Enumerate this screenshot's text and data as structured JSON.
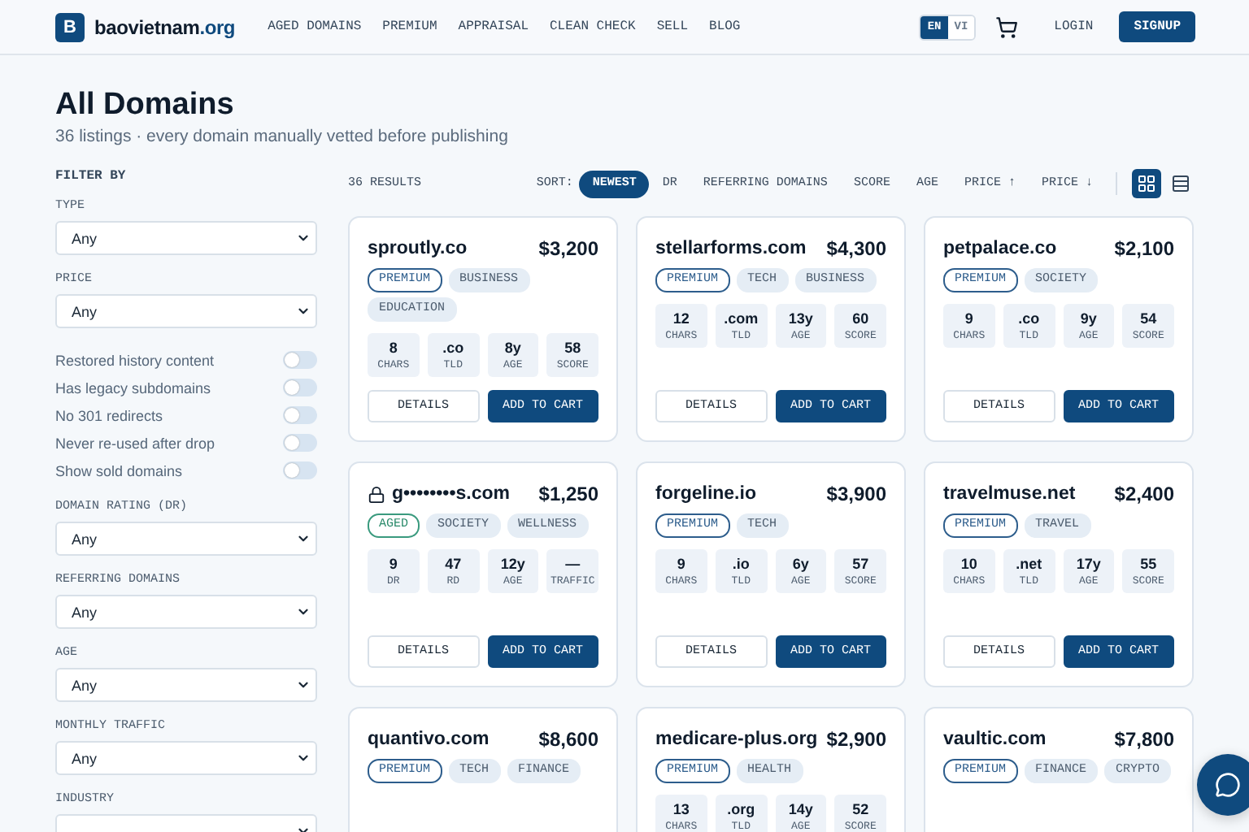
{
  "header": {
    "logo_letter": "B",
    "logo_name": "baovietnam",
    "logo_tld": ".org",
    "nav": [
      "AGED DOMAINS",
      "PREMIUM",
      "APPRAISAL",
      "CLEAN CHECK",
      "SELL",
      "BLOG"
    ],
    "languages": [
      {
        "label": "EN",
        "selected": true
      },
      {
        "label": "VI",
        "selected": false
      }
    ],
    "login": "LOGIN",
    "signup": "SIGNUP"
  },
  "page": {
    "title": "All Domains",
    "subtitle": "36 listings · every domain manually vetted before publishing"
  },
  "sidebar": {
    "title": "FILTER BY",
    "filters": [
      {
        "kind": "select",
        "label": "TYPE",
        "value": "Any"
      },
      {
        "kind": "select",
        "label": "PRICE",
        "value": "Any"
      },
      {
        "kind": "toggle",
        "label": "Restored history content",
        "on": false
      },
      {
        "kind": "toggle",
        "label": "Has legacy subdomains",
        "on": false
      },
      {
        "kind": "toggle",
        "label": "No 301 redirects",
        "on": false
      },
      {
        "kind": "toggle",
        "label": "Never re-used after drop",
        "on": false
      },
      {
        "kind": "toggle",
        "label": "Show sold domains",
        "on": false
      },
      {
        "kind": "select",
        "label": "DOMAIN RATING (DR)",
        "value": "Any"
      },
      {
        "kind": "select",
        "label": "REFERRING DOMAINS",
        "value": "Any"
      },
      {
        "kind": "select",
        "label": "AGE",
        "value": "Any"
      },
      {
        "kind": "select",
        "label": "MONTHLY TRAFFIC",
        "value": "Any"
      },
      {
        "kind": "select",
        "label": "INDUSTRY"
      }
    ]
  },
  "results": {
    "count": "36 RESULTS",
    "sort_label": "SORT:",
    "sort_options": [
      {
        "label": "NEWEST",
        "selected": true
      },
      {
        "label": "DR",
        "selected": false
      },
      {
        "label": "REFERRING DOMAINS",
        "selected": false
      },
      {
        "label": "SCORE",
        "selected": false
      },
      {
        "label": "AGE",
        "selected": false
      },
      {
        "label": "PRICE ↑",
        "selected": false
      },
      {
        "label": "PRICE ↓",
        "selected": false
      }
    ],
    "view_modes": [
      {
        "kind": "grid",
        "selected": true
      },
      {
        "kind": "list",
        "selected": false
      }
    ]
  },
  "listings": [
    {
      "name": "sproutly.co",
      "locked": false,
      "price": "$3,200",
      "tags": [
        {
          "kind": "premium",
          "label": "PREMIUM"
        },
        {
          "kind": "category",
          "label": "BUSINESS"
        },
        {
          "kind": "category",
          "label": "EDUCATION"
        }
      ],
      "stats": [
        {
          "value": "8",
          "label": "CHARS"
        },
        {
          "value": ".co",
          "label": "TLD"
        },
        {
          "value": "8y",
          "label": "AGE"
        },
        {
          "value": "58",
          "label": "SCORE"
        }
      ],
      "details": "DETAILS",
      "add": "ADD TO CART"
    },
    {
      "name": "stellarforms.com",
      "locked": false,
      "price": "$4,300",
      "tags": [
        {
          "kind": "premium",
          "label": "PREMIUM"
        },
        {
          "kind": "category",
          "label": "TECH"
        },
        {
          "kind": "category",
          "label": "BUSINESS"
        }
      ],
      "stats": [
        {
          "value": "12",
          "label": "CHARS"
        },
        {
          "value": ".com",
          "label": "TLD"
        },
        {
          "value": "13y",
          "label": "AGE"
        },
        {
          "value": "60",
          "label": "SCORE"
        }
      ],
      "details": "DETAILS",
      "add": "ADD TO CART"
    },
    {
      "name": "petpalace.co",
      "locked": false,
      "price": "$2,100",
      "tags": [
        {
          "kind": "premium",
          "label": "PREMIUM"
        },
        {
          "kind": "category",
          "label": "SOCIETY"
        }
      ],
      "stats": [
        {
          "value": "9",
          "label": "CHARS"
        },
        {
          "value": ".co",
          "label": "TLD"
        },
        {
          "value": "9y",
          "label": "AGE"
        },
        {
          "value": "54",
          "label": "SCORE"
        }
      ],
      "details": "DETAILS",
      "add": "ADD TO CART"
    },
    {
      "name": "g••••••••s.com",
      "locked": true,
      "price": "$1,250",
      "tags": [
        {
          "kind": "aged",
          "label": "AGED"
        },
        {
          "kind": "category",
          "label": "SOCIETY"
        },
        {
          "kind": "category",
          "label": "WELLNESS"
        }
      ],
      "stats": [
        {
          "value": "9",
          "label": "DR"
        },
        {
          "value": "47",
          "label": "RD"
        },
        {
          "value": "12y",
          "label": "AGE"
        },
        {
          "value": "—",
          "label": "TRAFFIC"
        }
      ],
      "details": "DETAILS",
      "add": "ADD TO CART"
    },
    {
      "name": "forgeline.io",
      "locked": false,
      "price": "$3,900",
      "tags": [
        {
          "kind": "premium",
          "label": "PREMIUM"
        },
        {
          "kind": "category",
          "label": "TECH"
        }
      ],
      "stats": [
        {
          "value": "9",
          "label": "CHARS"
        },
        {
          "value": ".io",
          "label": "TLD"
        },
        {
          "value": "6y",
          "label": "AGE"
        },
        {
          "value": "57",
          "label": "SCORE"
        }
      ],
      "details": "DETAILS",
      "add": "ADD TO CART"
    },
    {
      "name": "travelmuse.net",
      "locked": false,
      "price": "$2,400",
      "tags": [
        {
          "kind": "premium",
          "label": "PREMIUM"
        },
        {
          "kind": "category",
          "label": "TRAVEL"
        }
      ],
      "stats": [
        {
          "value": "10",
          "label": "CHARS"
        },
        {
          "value": ".net",
          "label": "TLD"
        },
        {
          "value": "17y",
          "label": "AGE"
        },
        {
          "value": "55",
          "label": "SCORE"
        }
      ],
      "details": "DETAILS",
      "add": "ADD TO CART"
    },
    {
      "name": "quantivo.com",
      "locked": false,
      "price": "$8,600",
      "tags": [
        {
          "kind": "premium",
          "label": "PREMIUM"
        },
        {
          "kind": "category",
          "label": "TECH"
        },
        {
          "kind": "category",
          "label": "FINANCE"
        }
      ]
    },
    {
      "name": "medicare-plus.org",
      "locked": false,
      "price": "$2,900",
      "tags": [
        {
          "kind": "premium",
          "label": "PREMIUM"
        },
        {
          "kind": "category",
          "label": "HEALTH"
        }
      ],
      "stats": [
        {
          "value": "13",
          "label": "CHARS"
        },
        {
          "value": ".org",
          "label": "TLD"
        },
        {
          "value": "14y",
          "label": "AGE"
        },
        {
          "value": "52",
          "label": "SCORE"
        }
      ]
    },
    {
      "name": "vaultic.com",
      "locked": false,
      "price": "$7,800",
      "tags": [
        {
          "kind": "premium",
          "label": "PREMIUM"
        },
        {
          "kind": "category",
          "label": "FINANCE"
        },
        {
          "kind": "category",
          "label": "CRYPTO"
        }
      ]
    }
  ]
}
